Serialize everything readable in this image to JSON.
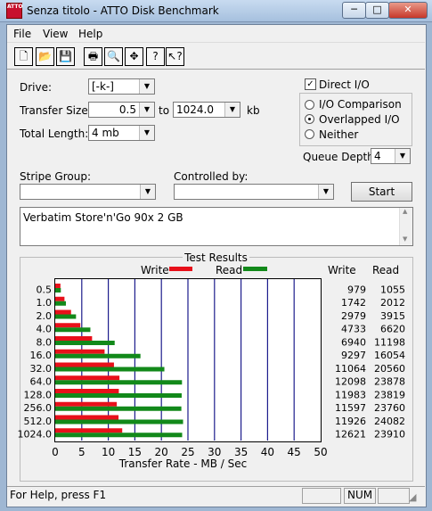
{
  "window": {
    "title": "Senza titolo - ATTO Disk Benchmark",
    "icon": "atto-app-icon"
  },
  "window_controls": {
    "minimize": "─",
    "maximize": "□",
    "close": "✕"
  },
  "menu": [
    "File",
    "View",
    "Help"
  ],
  "toolbar": [
    "new-icon",
    "open-icon",
    "save-icon",
    "print-icon",
    "print-preview-icon",
    "move-icon",
    "help-icon",
    "context-help-icon"
  ],
  "form": {
    "drive_label": "Drive:",
    "drive_value": "[-k-]",
    "transfer_size_label": "Transfer Size:",
    "transfer_from": "0.5",
    "to_label": "to",
    "transfer_to": "1024.0",
    "kb_label": "kb",
    "total_length_label": "Total Length:",
    "total_length_value": "4 mb",
    "direct_io_label": "Direct I/O",
    "direct_io_checked": true,
    "io_options": [
      {
        "label": "I/O Comparison",
        "selected": false
      },
      {
        "label": "Overlapped I/O",
        "selected": true
      },
      {
        "label": "Neither",
        "selected": false
      }
    ],
    "queue_depth_label": "Queue Depth:",
    "queue_depth_value": "4",
    "stripe_group_label": "Stripe Group:",
    "stripe_group_value": "",
    "controlled_by_label": "Controlled by:",
    "controlled_by_value": "",
    "start_button": "Start",
    "description": "Verbatim Store'n'Go 90x 2 GB"
  },
  "chart_data": {
    "type": "bar",
    "title": "Test Results",
    "xlabel": "Transfer Rate - MB / Sec",
    "xlim": [
      0,
      50
    ],
    "xticks": [
      "0",
      "5",
      "10",
      "15",
      "20",
      "25",
      "30",
      "35",
      "40",
      "45",
      "50"
    ],
    "categories": [
      "0.5",
      "1.0",
      "2.0",
      "4.0",
      "8.0",
      "16.0",
      "32.0",
      "64.0",
      "128.0",
      "256.0",
      "512.0",
      "1024.0"
    ],
    "series": [
      {
        "name": "Write",
        "color": "#e8101a",
        "values": [
          979,
          1742,
          2979,
          4733,
          6940,
          9297,
          11064,
          12098,
          11983,
          11597,
          11926,
          12621
        ]
      },
      {
        "name": "Read",
        "color": "#12891a",
        "values": [
          1055,
          2012,
          3915,
          6620,
          11198,
          16054,
          20560,
          23878,
          23819,
          23760,
          24082,
          23910
        ]
      }
    ],
    "table_headers": {
      "write": "Write",
      "read": "Read"
    },
    "grid": true,
    "legend": "top"
  },
  "status": {
    "help_text": "For Help, press F1",
    "indicator": "NUM"
  }
}
